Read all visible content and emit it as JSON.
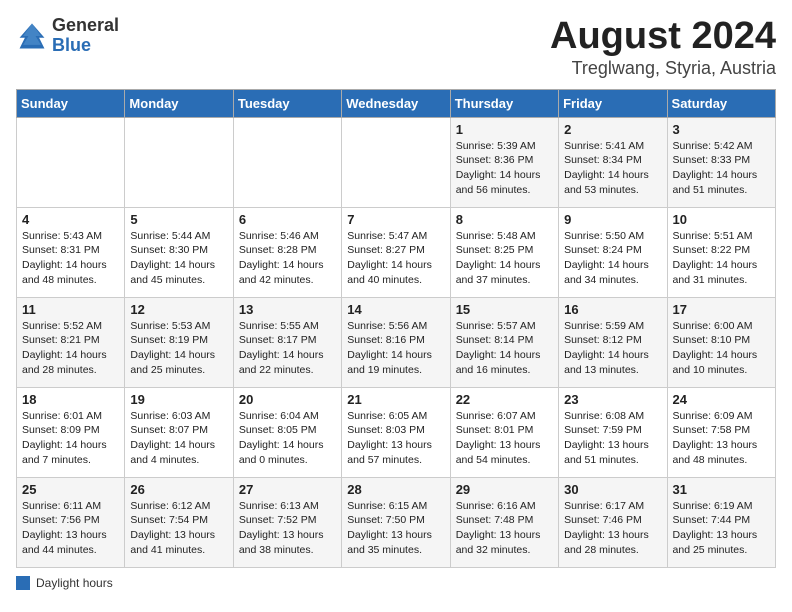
{
  "header": {
    "logo_general": "General",
    "logo_blue": "Blue",
    "month_year": "August 2024",
    "location": "Treglwang, Styria, Austria"
  },
  "columns": [
    "Sunday",
    "Monday",
    "Tuesday",
    "Wednesday",
    "Thursday",
    "Friday",
    "Saturday"
  ],
  "weeks": [
    [
      {
        "day": "",
        "info": ""
      },
      {
        "day": "",
        "info": ""
      },
      {
        "day": "",
        "info": ""
      },
      {
        "day": "",
        "info": ""
      },
      {
        "day": "1",
        "info": "Sunrise: 5:39 AM\nSunset: 8:36 PM\nDaylight: 14 hours\nand 56 minutes."
      },
      {
        "day": "2",
        "info": "Sunrise: 5:41 AM\nSunset: 8:34 PM\nDaylight: 14 hours\nand 53 minutes."
      },
      {
        "day": "3",
        "info": "Sunrise: 5:42 AM\nSunset: 8:33 PM\nDaylight: 14 hours\nand 51 minutes."
      }
    ],
    [
      {
        "day": "4",
        "info": "Sunrise: 5:43 AM\nSunset: 8:31 PM\nDaylight: 14 hours\nand 48 minutes."
      },
      {
        "day": "5",
        "info": "Sunrise: 5:44 AM\nSunset: 8:30 PM\nDaylight: 14 hours\nand 45 minutes."
      },
      {
        "day": "6",
        "info": "Sunrise: 5:46 AM\nSunset: 8:28 PM\nDaylight: 14 hours\nand 42 minutes."
      },
      {
        "day": "7",
        "info": "Sunrise: 5:47 AM\nSunset: 8:27 PM\nDaylight: 14 hours\nand 40 minutes."
      },
      {
        "day": "8",
        "info": "Sunrise: 5:48 AM\nSunset: 8:25 PM\nDaylight: 14 hours\nand 37 minutes."
      },
      {
        "day": "9",
        "info": "Sunrise: 5:50 AM\nSunset: 8:24 PM\nDaylight: 14 hours\nand 34 minutes."
      },
      {
        "day": "10",
        "info": "Sunrise: 5:51 AM\nSunset: 8:22 PM\nDaylight: 14 hours\nand 31 minutes."
      }
    ],
    [
      {
        "day": "11",
        "info": "Sunrise: 5:52 AM\nSunset: 8:21 PM\nDaylight: 14 hours\nand 28 minutes."
      },
      {
        "day": "12",
        "info": "Sunrise: 5:53 AM\nSunset: 8:19 PM\nDaylight: 14 hours\nand 25 minutes."
      },
      {
        "day": "13",
        "info": "Sunrise: 5:55 AM\nSunset: 8:17 PM\nDaylight: 14 hours\nand 22 minutes."
      },
      {
        "day": "14",
        "info": "Sunrise: 5:56 AM\nSunset: 8:16 PM\nDaylight: 14 hours\nand 19 minutes."
      },
      {
        "day": "15",
        "info": "Sunrise: 5:57 AM\nSunset: 8:14 PM\nDaylight: 14 hours\nand 16 minutes."
      },
      {
        "day": "16",
        "info": "Sunrise: 5:59 AM\nSunset: 8:12 PM\nDaylight: 14 hours\nand 13 minutes."
      },
      {
        "day": "17",
        "info": "Sunrise: 6:00 AM\nSunset: 8:10 PM\nDaylight: 14 hours\nand 10 minutes."
      }
    ],
    [
      {
        "day": "18",
        "info": "Sunrise: 6:01 AM\nSunset: 8:09 PM\nDaylight: 14 hours\nand 7 minutes."
      },
      {
        "day": "19",
        "info": "Sunrise: 6:03 AM\nSunset: 8:07 PM\nDaylight: 14 hours\nand 4 minutes."
      },
      {
        "day": "20",
        "info": "Sunrise: 6:04 AM\nSunset: 8:05 PM\nDaylight: 14 hours\nand 0 minutes."
      },
      {
        "day": "21",
        "info": "Sunrise: 6:05 AM\nSunset: 8:03 PM\nDaylight: 13 hours\nand 57 minutes."
      },
      {
        "day": "22",
        "info": "Sunrise: 6:07 AM\nSunset: 8:01 PM\nDaylight: 13 hours\nand 54 minutes."
      },
      {
        "day": "23",
        "info": "Sunrise: 6:08 AM\nSunset: 7:59 PM\nDaylight: 13 hours\nand 51 minutes."
      },
      {
        "day": "24",
        "info": "Sunrise: 6:09 AM\nSunset: 7:58 PM\nDaylight: 13 hours\nand 48 minutes."
      }
    ],
    [
      {
        "day": "25",
        "info": "Sunrise: 6:11 AM\nSunset: 7:56 PM\nDaylight: 13 hours\nand 44 minutes."
      },
      {
        "day": "26",
        "info": "Sunrise: 6:12 AM\nSunset: 7:54 PM\nDaylight: 13 hours\nand 41 minutes."
      },
      {
        "day": "27",
        "info": "Sunrise: 6:13 AM\nSunset: 7:52 PM\nDaylight: 13 hours\nand 38 minutes."
      },
      {
        "day": "28",
        "info": "Sunrise: 6:15 AM\nSunset: 7:50 PM\nDaylight: 13 hours\nand 35 minutes."
      },
      {
        "day": "29",
        "info": "Sunrise: 6:16 AM\nSunset: 7:48 PM\nDaylight: 13 hours\nand 32 minutes."
      },
      {
        "day": "30",
        "info": "Sunrise: 6:17 AM\nSunset: 7:46 PM\nDaylight: 13 hours\nand 28 minutes."
      },
      {
        "day": "31",
        "info": "Sunrise: 6:19 AM\nSunset: 7:44 PM\nDaylight: 13 hours\nand 25 minutes."
      }
    ]
  ],
  "legend": {
    "box_label": "Daylight hours"
  }
}
